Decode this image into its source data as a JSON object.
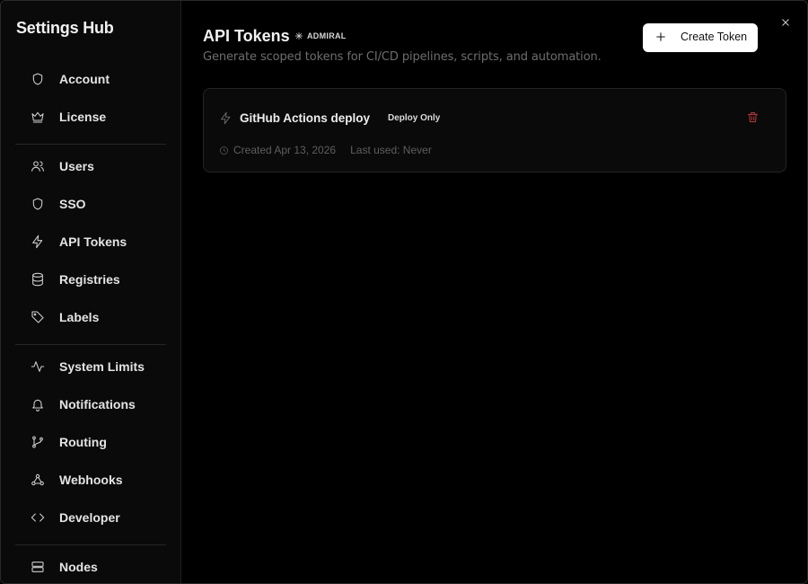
{
  "sidebar": {
    "title": "Settings Hub",
    "groups": [
      [
        {
          "label": "Account",
          "icon": "shield-icon"
        },
        {
          "label": "License",
          "icon": "crown-icon"
        }
      ],
      [
        {
          "label": "Users",
          "icon": "users-icon"
        },
        {
          "label": "SSO",
          "icon": "shield-icon"
        },
        {
          "label": "API Tokens",
          "icon": "lightning-icon"
        },
        {
          "label": "Registries",
          "icon": "database-icon"
        },
        {
          "label": "Labels",
          "icon": "tag-icon"
        }
      ],
      [
        {
          "label": "System Limits",
          "icon": "activity-icon"
        },
        {
          "label": "Notifications",
          "icon": "bell-icon"
        },
        {
          "label": "Routing",
          "icon": "git-branch-icon"
        },
        {
          "label": "Webhooks",
          "icon": "webhook-icon"
        },
        {
          "label": "Developer",
          "icon": "code-icon"
        }
      ],
      [
        {
          "label": "Nodes",
          "icon": "server-icon"
        }
      ]
    ]
  },
  "header": {
    "title": "API Tokens",
    "tier_badge": "ADMIRAL",
    "subtitle": "Generate scoped tokens for CI/CD pipelines, scripts, and automation.",
    "create_label": "Create Token"
  },
  "tokens": [
    {
      "name": "GitHub Actions deploy",
      "scope": "Deploy Only",
      "created": "Created Apr 13, 2026",
      "last_used": "Last used: Never"
    }
  ],
  "colors": {
    "background": "#000000",
    "sidebar": "#0a0a0a",
    "delete": "#b83a3a",
    "primary_button": "#ffffff"
  }
}
